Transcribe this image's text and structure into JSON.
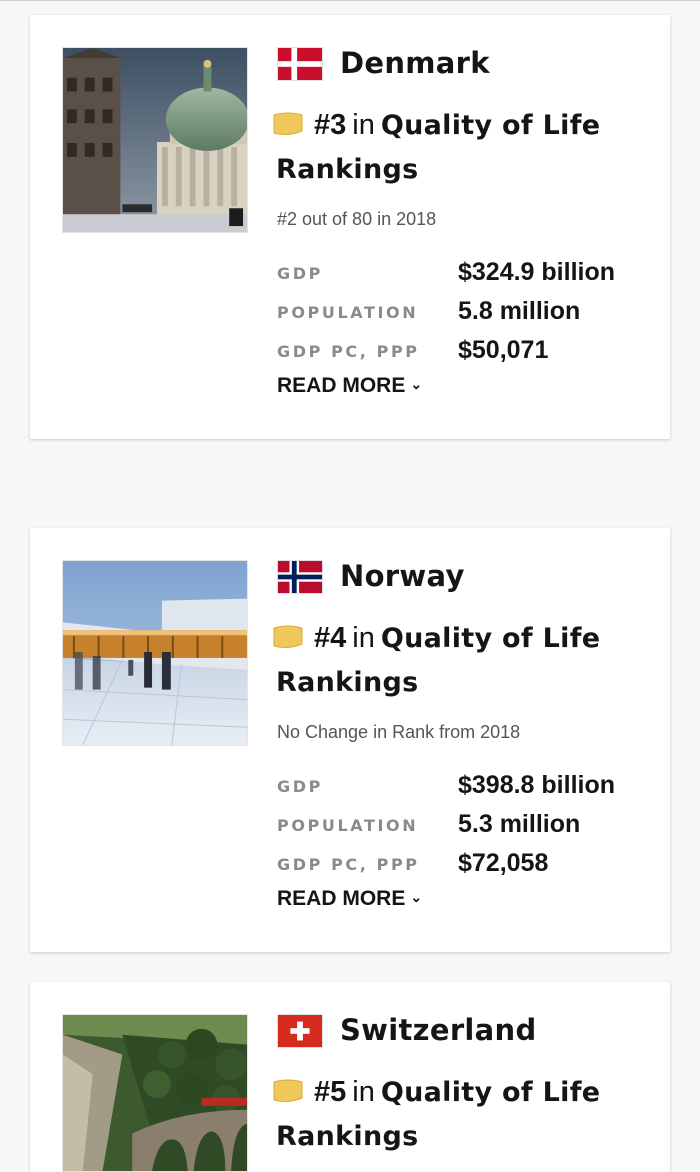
{
  "cards": [
    {
      "country": "Denmark",
      "rank": "#3",
      "in_word": "in",
      "category_line1": "Quality of Life",
      "category_line2": "Rankings",
      "change_text": "#2 out of 80 in 2018",
      "stats": [
        {
          "label": "GDP",
          "value": "$324.9 billion"
        },
        {
          "label": "POPULATION",
          "value": "5.8 million"
        },
        {
          "label": "GDP PC, PPP",
          "value": "$50,071"
        }
      ],
      "read_more": "READ MORE",
      "flag_icon": "denmark-flag-icon",
      "photo": "copenhagen-church-photo"
    },
    {
      "country": "Norway",
      "rank": "#4",
      "in_word": "in",
      "category_line1": "Quality of Life",
      "category_line2": "Rankings",
      "change_text": "No Change in Rank from 2018",
      "stats": [
        {
          "label": "GDP",
          "value": "$398.8 billion"
        },
        {
          "label": "POPULATION",
          "value": "5.3 million"
        },
        {
          "label": "GDP PC, PPP",
          "value": "$72,058"
        }
      ],
      "read_more": "READ MORE",
      "flag_icon": "norway-flag-icon",
      "photo": "oslo-opera-house-photo"
    },
    {
      "country": "Switzerland",
      "rank": "#5",
      "in_word": "in",
      "category_line1": "Quality of Life",
      "category_line2": "Rankings",
      "flag_icon": "switzerland-flag-icon",
      "photo": "swiss-viaduct-train-photo"
    }
  ],
  "colors": {
    "denmark_red": "#c8102e",
    "norway_red": "#ba0c2f",
    "norway_blue": "#00205b",
    "swiss_red": "#d52b1e",
    "badge_gold": "#f0c75a"
  }
}
